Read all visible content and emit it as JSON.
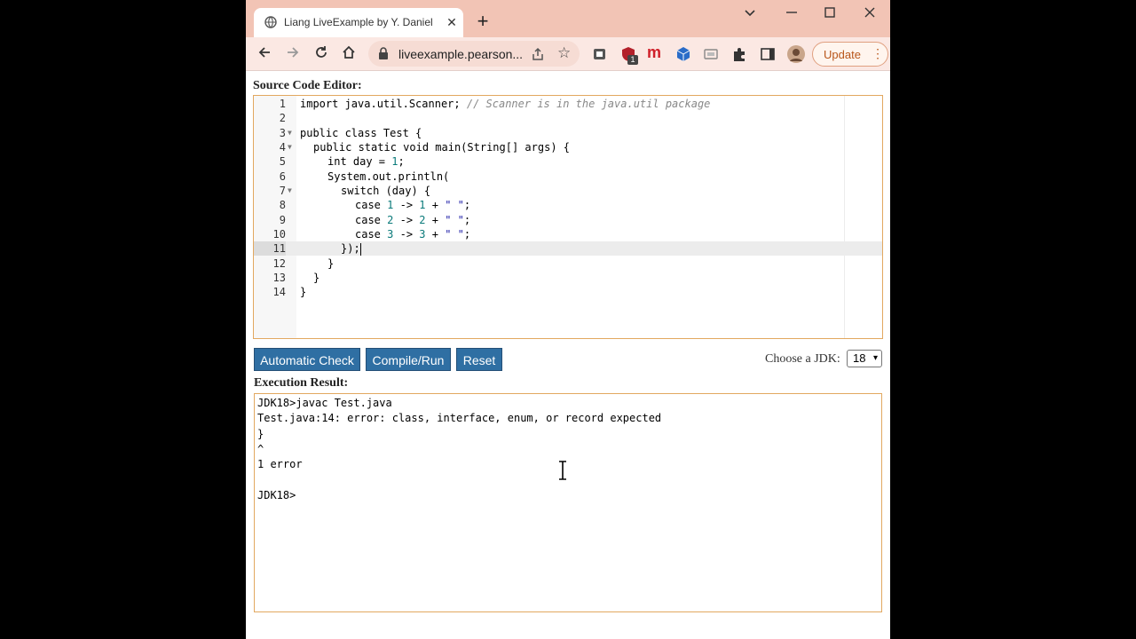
{
  "browser": {
    "tab_title": "Liang LiveExample by Y. Daniel Li",
    "tab_close": "✕",
    "new_tab": "+",
    "url": "liveexample.pearson...",
    "update_label": "Update",
    "ext_badge": "1"
  },
  "page": {
    "source_label": "Source Code Editor:",
    "editor": {
      "line_numbers": [
        "1",
        "2",
        "3",
        "4",
        "5",
        "6",
        "7",
        "8",
        "9",
        "10",
        "11",
        "12",
        "13",
        "14"
      ],
      "active_line": 11
    },
    "buttons": {
      "automatic_check": "Automatic Check",
      "compile_run": "Compile/Run",
      "reset": "Reset"
    },
    "jdk": {
      "label": "Choose a JDK:",
      "selected": "18"
    },
    "result_label": "Execution Result:",
    "result_lines": [
      "JDK18>javac Test.java",
      "Test.java:14: error: class, interface, enum, or record expected",
      "}",
      "^",
      "1 error",
      "",
      "JDK18>"
    ]
  },
  "code": {
    "l1_kw": "import",
    "l1_rest": " java.util.Scanner; ",
    "l1_comment": "// Scanner is in the java.util package",
    "l3_kw": "public class",
    "l3_rest": " Test {",
    "l4_kw": "public static void",
    "l4_rest": " main(String[] args) {",
    "l5_kw": "int",
    "l5_a": " day = ",
    "l5_num": "1",
    "l5_b": ";",
    "l6": "System.out.println(",
    "l7_kw": "switch",
    "l7_rest": " (day) {",
    "case_kw": "case",
    "arrow": " -> ",
    "plus": " + ",
    "str": "\" \"",
    "semi": ";",
    "n1": "1",
    "n2": "2",
    "n3": "3",
    "l11": "});",
    "l12": "}",
    "l13": "}",
    "l14": "}"
  }
}
